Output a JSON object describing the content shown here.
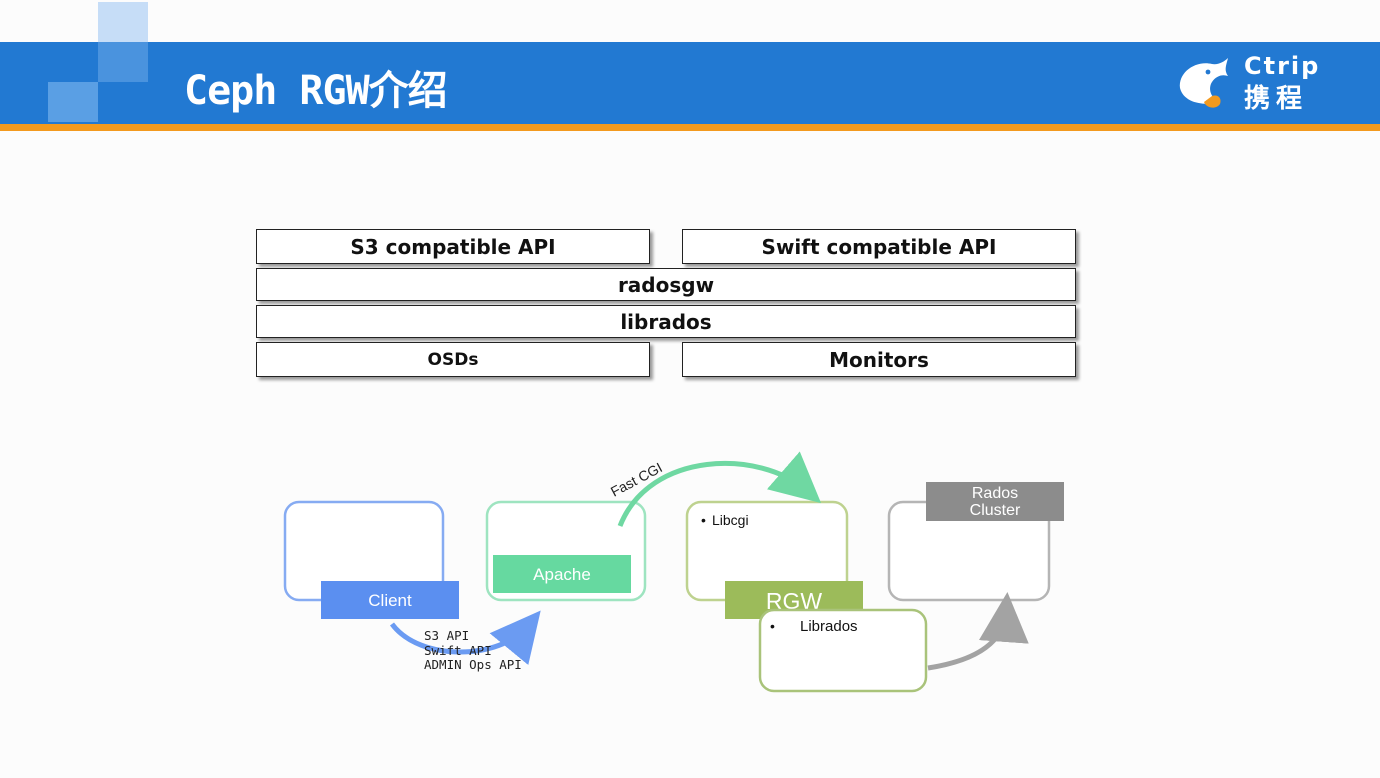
{
  "header": {
    "title": "Ceph RGW介绍",
    "logo": {
      "word": "Ctrip",
      "chinese": "携程",
      "icon": "dolphin-logo"
    }
  },
  "colors": {
    "header_blue": "#2279d2",
    "accent_orange": "#f39a1e",
    "client_blue": "#5b8ff0",
    "apache_green": "#66d9a0",
    "rgw_olive": "#9cbb5a",
    "rados_gray": "#8c8c8c"
  },
  "stack": {
    "s3_api": "S3 compatible API",
    "swift_api": "Swift compatible API",
    "radosgw": "radosgw",
    "librados": "librados",
    "osds": "OSDs",
    "monitors": "Monitors"
  },
  "flow": {
    "client": "Client",
    "apache": "Apache",
    "fastcgi": "Fast CGI",
    "libcgi": "Libcgi",
    "rgw": "RGW",
    "librados": "Librados",
    "rados_cluster_line1": "Rados",
    "rados_cluster_line2": "Cluster",
    "apis": [
      "S3 API",
      "Swift API",
      "ADMIN Ops API"
    ]
  }
}
